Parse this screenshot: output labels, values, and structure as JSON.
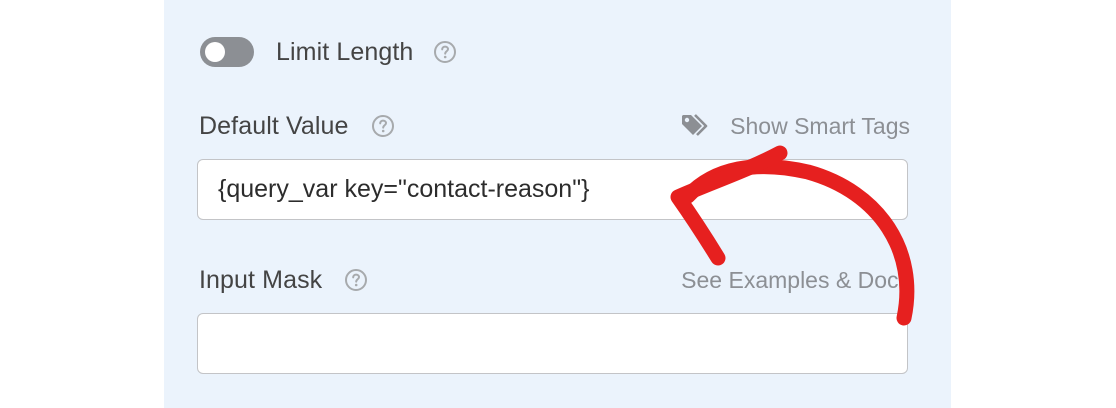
{
  "colors": {
    "panel_bg": "#ebf3fc",
    "toggle_off": "#8c8f94",
    "label_text": "#444444",
    "link_text": "#8c8f94",
    "annotation_arrow": "#e6201f"
  },
  "limit_length": {
    "label": "Limit Length",
    "toggle_state": "off",
    "help_icon": "question-circle-icon"
  },
  "default_value": {
    "label": "Default Value",
    "help_icon": "question-circle-icon",
    "smart_tags_icon": "tags-icon",
    "smart_tags_link": "Show Smart Tags",
    "value": "{query_var key=\"contact-reason\"}"
  },
  "input_mask": {
    "label": "Input Mask",
    "help_icon": "question-circle-icon",
    "docs_link": "See Examples & Docs",
    "value": ""
  },
  "annotation": {
    "icon": "curved-arrow-icon"
  }
}
